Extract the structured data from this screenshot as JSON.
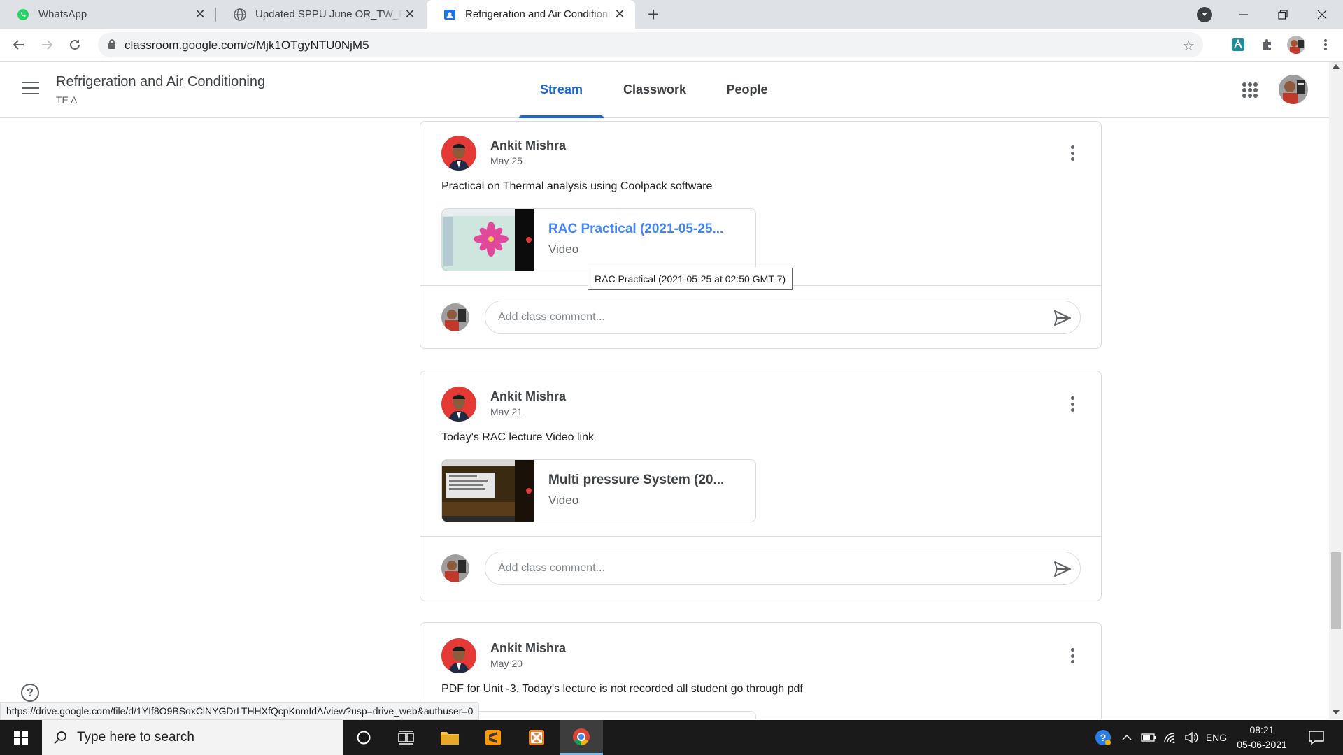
{
  "browser": {
    "tabs": [
      {
        "title": "WhatsApp",
        "icon": "whatsapp-icon",
        "active": false
      },
      {
        "title": "Updated SPPU June OR_TW_PR exam",
        "icon": "globe-icon",
        "active": false
      },
      {
        "title": "Refrigeration and Air Conditioning",
        "icon": "classroom-icon",
        "active": true
      }
    ],
    "new_tab_label": "+",
    "url": "classroom.google.com/c/Mjk1OTgyNTU0NjM5"
  },
  "classroom": {
    "class_title": "Refrigeration and Air Conditioning",
    "class_section": "TE A",
    "nav_tabs": [
      {
        "label": "Stream",
        "active": true
      },
      {
        "label": "Classwork",
        "active": false
      },
      {
        "label": "People",
        "active": false
      }
    ]
  },
  "posts": [
    {
      "author": "Ankit Mishra",
      "date": "May 25",
      "text": "Practical on Thermal analysis using Coolpack software",
      "attachment": {
        "title": "RAC Practical (2021-05-25...",
        "type": "Video",
        "hovered": true
      },
      "comment_placeholder": "Add class comment..."
    },
    {
      "author": "Ankit Mishra",
      "date": "May 21",
      "text": "Today's RAC lecture Video link",
      "attachment": {
        "title": "Multi pressure System (20...",
        "type": "Video",
        "hovered": false
      },
      "comment_placeholder": "Add class comment..."
    },
    {
      "author": "Ankit Mishra",
      "date": "May 20",
      "text": "PDF for Unit -3, Today's lecture is not recorded all student go through pdf"
    }
  ],
  "tooltip": "RAC Practical (2021-05-25 at 02:50 GMT-7)",
  "status_url": "https://drive.google.com/file/d/1YIf8O9BSoxClNYGDrLTHHXfQcpKnmIdA/view?usp=drive_web&authuser=0",
  "taskbar": {
    "search_placeholder": "Type here to search",
    "language": "ENG",
    "time": "08:21",
    "date": "05-06-2021"
  },
  "colors": {
    "accent": "#1967d2",
    "link": "#4285f4",
    "border": "#dadce0"
  }
}
